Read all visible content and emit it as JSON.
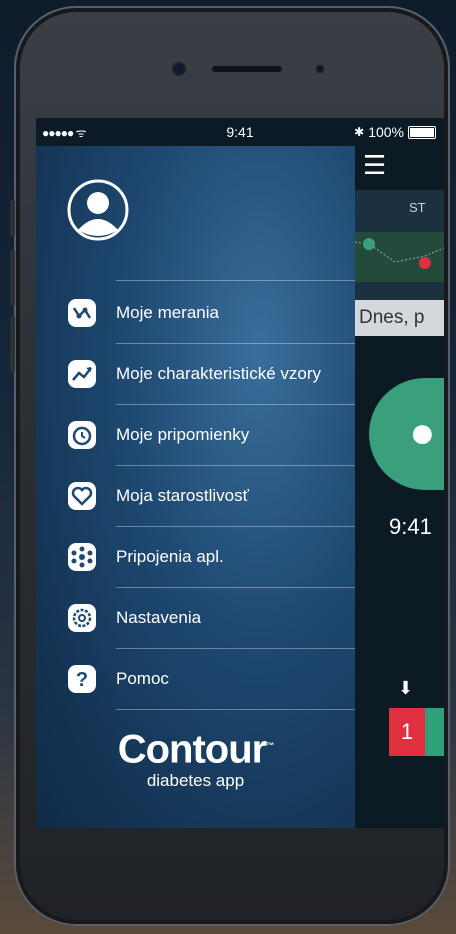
{
  "status": {
    "signal": "●●●●● ᯤ",
    "time": "9:41",
    "battery": "100%"
  },
  "app": {
    "day": "ST",
    "today_text": "Dnes, p",
    "time": "9:41",
    "badge": "1",
    "colors": {
      "green": "#3aa07c",
      "red": "#e03040"
    }
  },
  "menu": {
    "items": [
      {
        "label": "Moje merania",
        "icon": "measurements-icon"
      },
      {
        "label": "Moje charakteristické vzory",
        "icon": "trends-icon"
      },
      {
        "label": "Moje pripomienky",
        "icon": "reminder-icon"
      },
      {
        "label": "Moja starostlivosť",
        "icon": "care-icon"
      },
      {
        "label": "Pripojenia apl.",
        "icon": "connections-icon"
      },
      {
        "label": "Nastavenia",
        "icon": "settings-icon"
      },
      {
        "label": "Pomoc",
        "icon": "help-icon"
      }
    ]
  },
  "logo": {
    "brand": "Contour",
    "trademark": "™",
    "subtitle": "diabetes app"
  }
}
